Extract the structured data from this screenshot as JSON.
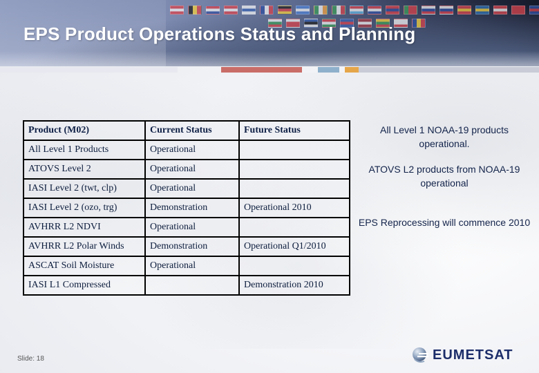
{
  "slide": {
    "title": "EPS Product Operations Status and Planning",
    "slide_number_label": "Slide: 18",
    "logo_text": "EUMETSAT"
  },
  "header": {
    "flags_row1": [
      {
        "name": "austria",
        "colors": [
          "#d6434b",
          "#f2f2f2",
          "#d6434b"
        ],
        "dir": "h"
      },
      {
        "name": "belgium",
        "colors": [
          "#222",
          "#f4d03f",
          "#d6434b"
        ],
        "dir": "v"
      },
      {
        "name": "croatia",
        "colors": [
          "#d6434b",
          "#f2f2f2",
          "#2f4fa0"
        ],
        "dir": "h"
      },
      {
        "name": "denmark",
        "colors": [
          "#d6434b",
          "#f2f2f2",
          "#d6434b"
        ],
        "dir": "h"
      },
      {
        "name": "finland",
        "colors": [
          "#f2f2f2",
          "#3a62b0",
          "#f2f2f2"
        ],
        "dir": "h"
      },
      {
        "name": "france",
        "colors": [
          "#2f4fa0",
          "#f2f2f2",
          "#d6434b"
        ],
        "dir": "v"
      },
      {
        "name": "germany",
        "colors": [
          "#222",
          "#d6434b",
          "#f4d03f"
        ],
        "dir": "h"
      },
      {
        "name": "greece",
        "colors": [
          "#4d7fd0",
          "#f2f2f2",
          "#4d7fd0"
        ],
        "dir": "h"
      },
      {
        "name": "ireland",
        "colors": [
          "#3d9b5a",
          "#f2f2f2",
          "#f0a040"
        ],
        "dir": "v"
      },
      {
        "name": "italy",
        "colors": [
          "#3d9b5a",
          "#f2f2f2",
          "#d6434b"
        ],
        "dir": "v"
      },
      {
        "name": "luxembourg",
        "colors": [
          "#d6434b",
          "#f2f2f2",
          "#5fb3e0"
        ],
        "dir": "h"
      },
      {
        "name": "netherlands",
        "colors": [
          "#d6434b",
          "#f2f2f2",
          "#2f4fa0"
        ],
        "dir": "h"
      },
      {
        "name": "norway",
        "colors": [
          "#d6434b",
          "#2f4fa0",
          "#d6434b"
        ],
        "dir": "h"
      },
      {
        "name": "portugal",
        "colors": [
          "#3d9b5a",
          "#d6434b",
          "#d6434b"
        ],
        "dir": "v"
      },
      {
        "name": "slovakia",
        "colors": [
          "#f2f2f2",
          "#2f4fa0",
          "#d6434b"
        ],
        "dir": "h"
      },
      {
        "name": "slovenia",
        "colors": [
          "#f2f2f2",
          "#2f4fa0",
          "#d6434b"
        ],
        "dir": "h"
      },
      {
        "name": "spain",
        "colors": [
          "#d6434b",
          "#f4d03f",
          "#d6434b"
        ],
        "dir": "h"
      },
      {
        "name": "sweden",
        "colors": [
          "#2f6fb0",
          "#f4d03f",
          "#2f6fb0"
        ],
        "dir": "h"
      },
      {
        "name": "switzerland",
        "colors": [
          "#d6434b",
          "#f2f2f2",
          "#d6434b"
        ],
        "dir": "h"
      },
      {
        "name": "turkey",
        "colors": [
          "#d6434b",
          "#d6434b",
          "#d6434b"
        ],
        "dir": "h"
      },
      {
        "name": "united-kingdom",
        "colors": [
          "#2f4fa0",
          "#d6434b",
          "#2f4fa0"
        ],
        "dir": "h"
      }
    ],
    "flags_row2": [
      {
        "name": "bulgaria",
        "colors": [
          "#f2f2f2",
          "#3d9b5a",
          "#d6434b"
        ],
        "dir": "h"
      },
      {
        "name": "czech-republic",
        "colors": [
          "#f2f2f2",
          "#d6434b",
          "#d6434b"
        ],
        "dir": "h"
      },
      {
        "name": "estonia",
        "colors": [
          "#3a62b0",
          "#222",
          "#f2f2f2"
        ],
        "dir": "h"
      },
      {
        "name": "hungary",
        "colors": [
          "#d6434b",
          "#f2f2f2",
          "#3d9b5a"
        ],
        "dir": "h"
      },
      {
        "name": "iceland",
        "colors": [
          "#3a62b0",
          "#d6434b",
          "#3a62b0"
        ],
        "dir": "h"
      },
      {
        "name": "latvia",
        "colors": [
          "#a33a44",
          "#f2f2f2",
          "#a33a44"
        ],
        "dir": "h"
      },
      {
        "name": "lithuania",
        "colors": [
          "#f4d03f",
          "#3d9b5a",
          "#d6434b"
        ],
        "dir": "h"
      },
      {
        "name": "poland",
        "colors": [
          "#f2f2f2",
          "#f2f2f2",
          "#d6434b"
        ],
        "dir": "h"
      },
      {
        "name": "romania",
        "colors": [
          "#2f4fa0",
          "#f4d03f",
          "#d6434b"
        ],
        "dir": "v"
      }
    ],
    "color_strip": [
      {
        "color": "#e8e9f0",
        "from": 0,
        "to": 0.33
      },
      {
        "color": "#c96d68",
        "from": 0.41,
        "to": 0.56
      },
      {
        "color": "#8fb0cc",
        "from": 0.59,
        "to": 0.63
      },
      {
        "color": "#e5a64a",
        "from": 0.64,
        "to": 0.665
      },
      {
        "color": "#c9cbd6",
        "from": 0.665,
        "to": 1
      }
    ]
  },
  "table": {
    "headers": [
      "Product (M02)",
      "Current Status",
      "Future Status"
    ],
    "rows": [
      [
        "All Level 1 Products",
        "Operational",
        ""
      ],
      [
        "ATOVS Level 2",
        "Operational",
        ""
      ],
      [
        "IASI Level 2 (twt, clp)",
        "Operational",
        ""
      ],
      [
        "IASI Level 2 (ozo, trg)",
        "Demonstration",
        "Operational  2010"
      ],
      [
        "AVHRR L2 NDVI",
        "Operational",
        ""
      ],
      [
        "AVHRR L2 Polar Winds",
        "Demonstration",
        "Operational  Q1/2010"
      ],
      [
        "ASCAT Soil Moisture",
        "Operational",
        ""
      ],
      [
        "IASI L1 Compressed",
        "",
        "Demonstration 2010"
      ]
    ]
  },
  "notes": [
    "All Level 1 NOAA-19 products operational.",
    "ATOVS L2 products from NOAA-19 operational",
    "EPS Reprocessing will commence 2010"
  ],
  "colors": {
    "table_text": "#0d1d3d",
    "logo_text": "#1c2d6a"
  }
}
